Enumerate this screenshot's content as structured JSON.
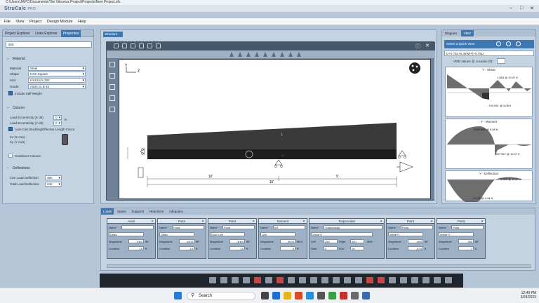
{
  "window": {
    "path": "C:\\Users\\JAPC\\Documents\\The Vitruvius Project\\Projects\\New Project.vfx",
    "app_name": "StruCalc",
    "app_suffix": "PRO"
  },
  "menu": [
    "File",
    "View",
    "Project",
    "Design Module",
    "Help"
  ],
  "left_panel": {
    "tabs": [
      "Project Explorer",
      "Links Explorer",
      "Properties"
    ],
    "name_value": "sss",
    "material_section": "Material",
    "fields": [
      {
        "label": "Material",
        "value": "Steel"
      },
      {
        "label": "Shape",
        "value": "HSS Square"
      },
      {
        "label": "Size",
        "value": "HSS4x4x.250"
      },
      {
        "label": "Grade",
        "value": "A500 Gr.B 46"
      }
    ],
    "include_self_weight": "Include Self Weight",
    "column_section": "Column",
    "load_ecc_x": "Load Eccentricity (X dir)",
    "load_ecc_y": "Load Eccentricity (Y dir)",
    "ecc_x_value": "0",
    "ecc_y_value": "0",
    "ecc_unit": "in",
    "auto_calc": "Auto-Calc Buckling/Effective Length Factor",
    "kx": "Kx (X Axis)",
    "ky": "Ky (Y Axis)",
    "cantilever": "Cantilever Column",
    "deflections_section": "Deflections",
    "live_load_defl": "Live Load Deflection",
    "live_load_value": "360",
    "total_load_defl": "Total Load Deflection",
    "total_load_value": "240"
  },
  "center": {
    "tab": "Structure",
    "dim_left": "10'",
    "dim_right": "5'",
    "dim_total": "15'",
    "axis_z": "Z",
    "axis_y": "Y"
  },
  "right_panel": {
    "tabs": [
      "Diagram",
      "VMD"
    ],
    "quick_view": "Select a Quick View:",
    "combo": "D+0.75L+0.45W(+)+0.75Lr",
    "vmd_location": "VMD Values @ Location (ft):",
    "diagrams": [
      {
        "title": "Y - Shear",
        "top": "1,063 @ 10.07 ft",
        "bottom": "-740.051 @ 5.08 ft"
      },
      {
        "title": "Y - Moment",
        "top": "2549.851 @ 6.08 ft",
        "bottom": "-837.967 @ 10.07 ft"
      },
      {
        "title": "Y - Deflection",
        "top": "0.000 @ 11.57 ft",
        "bottom": "-0.179 @ 4.94 ft"
      }
    ]
  },
  "bottom": {
    "tabs": [
      "Loads",
      "Spans",
      "Supports",
      "Reactions",
      "Adequacy"
    ],
    "cards": [
      {
        "title": "Axial",
        "name": "",
        "type": "Dead",
        "mag_label": "Magnitude",
        "mag": "-7000",
        "unit": "lbf",
        "loc_label": "Location",
        "loc": "15",
        "loc_unit": "ft"
      },
      {
        "title": "Point",
        "name": "Point",
        "type": "Dead",
        "mag_label": "Magnitude",
        "mag": "-1000",
        "unit": "lbf",
        "loc_label": "Location",
        "loc": "15",
        "loc_unit": "ft"
      },
      {
        "title": "Point",
        "name": "Point",
        "type": "Roof Live",
        "mag_label": "Magnitude",
        "mag": "-3000",
        "unit": "lbf",
        "loc_label": "Location",
        "loc": "10",
        "loc_unit": "ft"
      },
      {
        "title": "Moment",
        "name": "MT",
        "type": "Live",
        "mag_label": "Magnitude",
        "mag": "5000",
        "unit": "lbf-ft",
        "loc_label": "Location",
        "loc": "5",
        "loc_unit": "ft"
      },
      {
        "title": "Trapezoidal",
        "name": "Trapezoidal",
        "type": "Wind(+)",
        "mag_label": "Left",
        "mag": "250",
        "unit": "lbf/ft",
        "loc_label": "Start",
        "loc": "0",
        "loc_unit": "ft",
        "right_label": "Right",
        "right": "400",
        "end_label": "End",
        "end": "15"
      },
      {
        "title": "Point",
        "name": "Point",
        "type": "Wind(+)",
        "mag_label": "Magnitude",
        "mag": "-850",
        "unit": "lbf",
        "loc_label": "Location",
        "loc": "10.5",
        "loc_unit": "ft"
      },
      {
        "title": "Point",
        "name": "Point",
        "type": "Wind(+)",
        "mag_label": "Magnitude",
        "mag": "350",
        "unit": "lbf",
        "loc_label": "Location",
        "loc": "7",
        "loc_unit": "ft"
      }
    ],
    "name_label": "Name"
  },
  "taskbar": {
    "search": "Search",
    "time": "12:49 PM",
    "date": "6/24/2023"
  },
  "colors": {
    "accent": "#3f78b0",
    "panel": "#c4d3e2",
    "load": "#3a3a3a"
  }
}
